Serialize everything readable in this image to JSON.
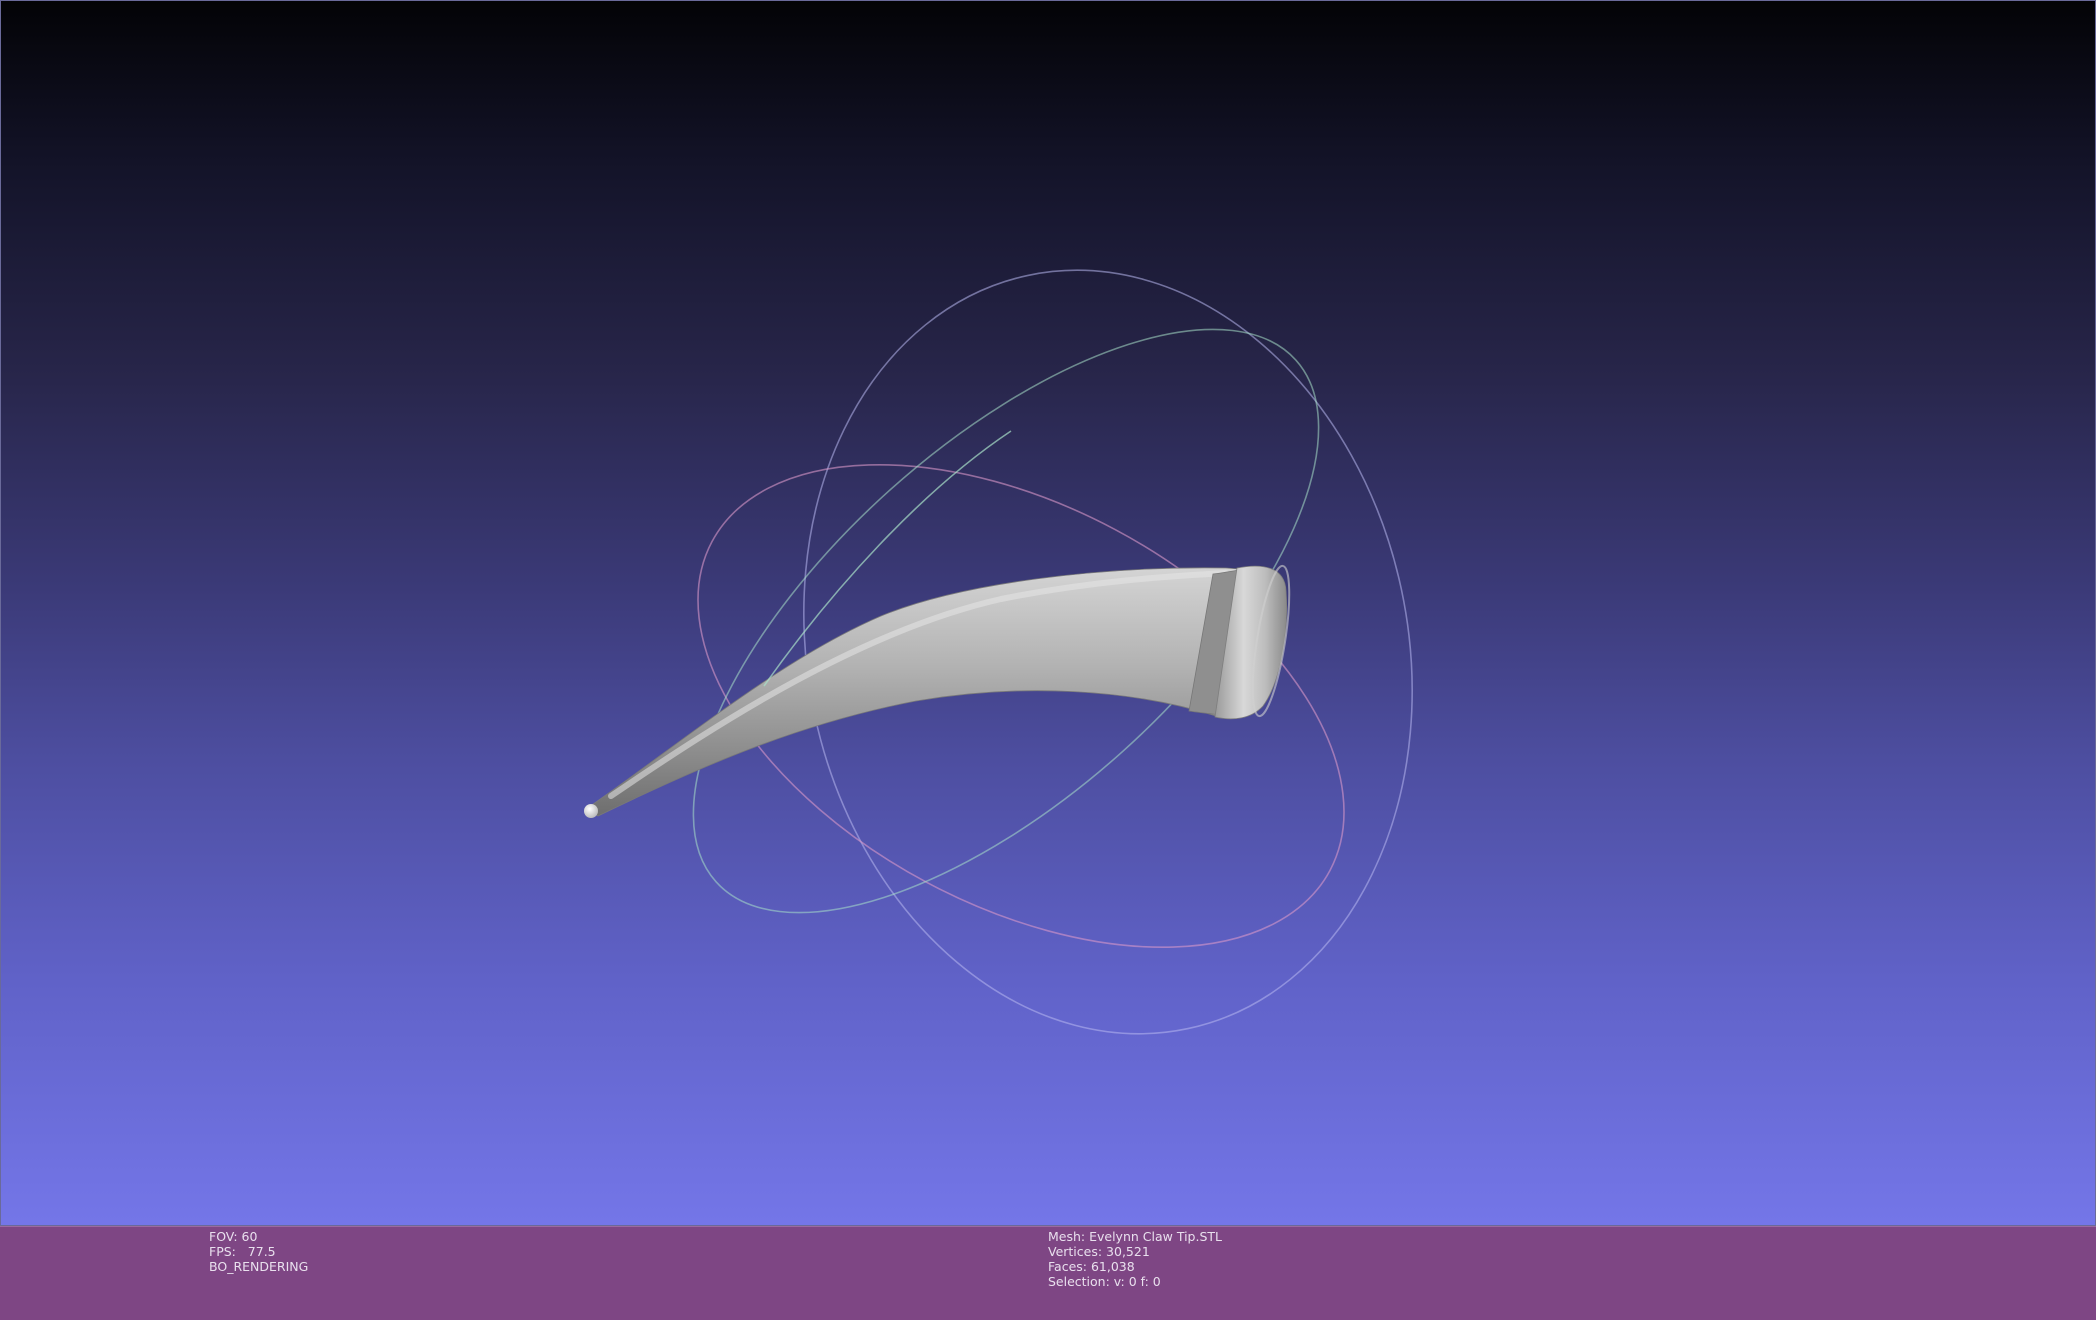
{
  "viewer": {
    "left_info": {
      "fov": "FOV: 60",
      "fps": "FPS:   77.5",
      "render_mode": "BO_RENDERING"
    },
    "right_info": {
      "mesh": "Mesh: Evelynn Claw Tip.STL",
      "vertices": "Vertices: 30,521",
      "faces": "Faces: 61,038",
      "selection": "Selection: v: 0 f: 0"
    }
  },
  "colors": {
    "background_top": "#030306",
    "background_bottom": "#7476e8",
    "info_bar": "#7e4684",
    "mesh": "#a8a8a8",
    "trackball_red": "#d898c8",
    "trackball_green": "#a8e0c8",
    "trackball_blue": "#b8b8f0"
  }
}
